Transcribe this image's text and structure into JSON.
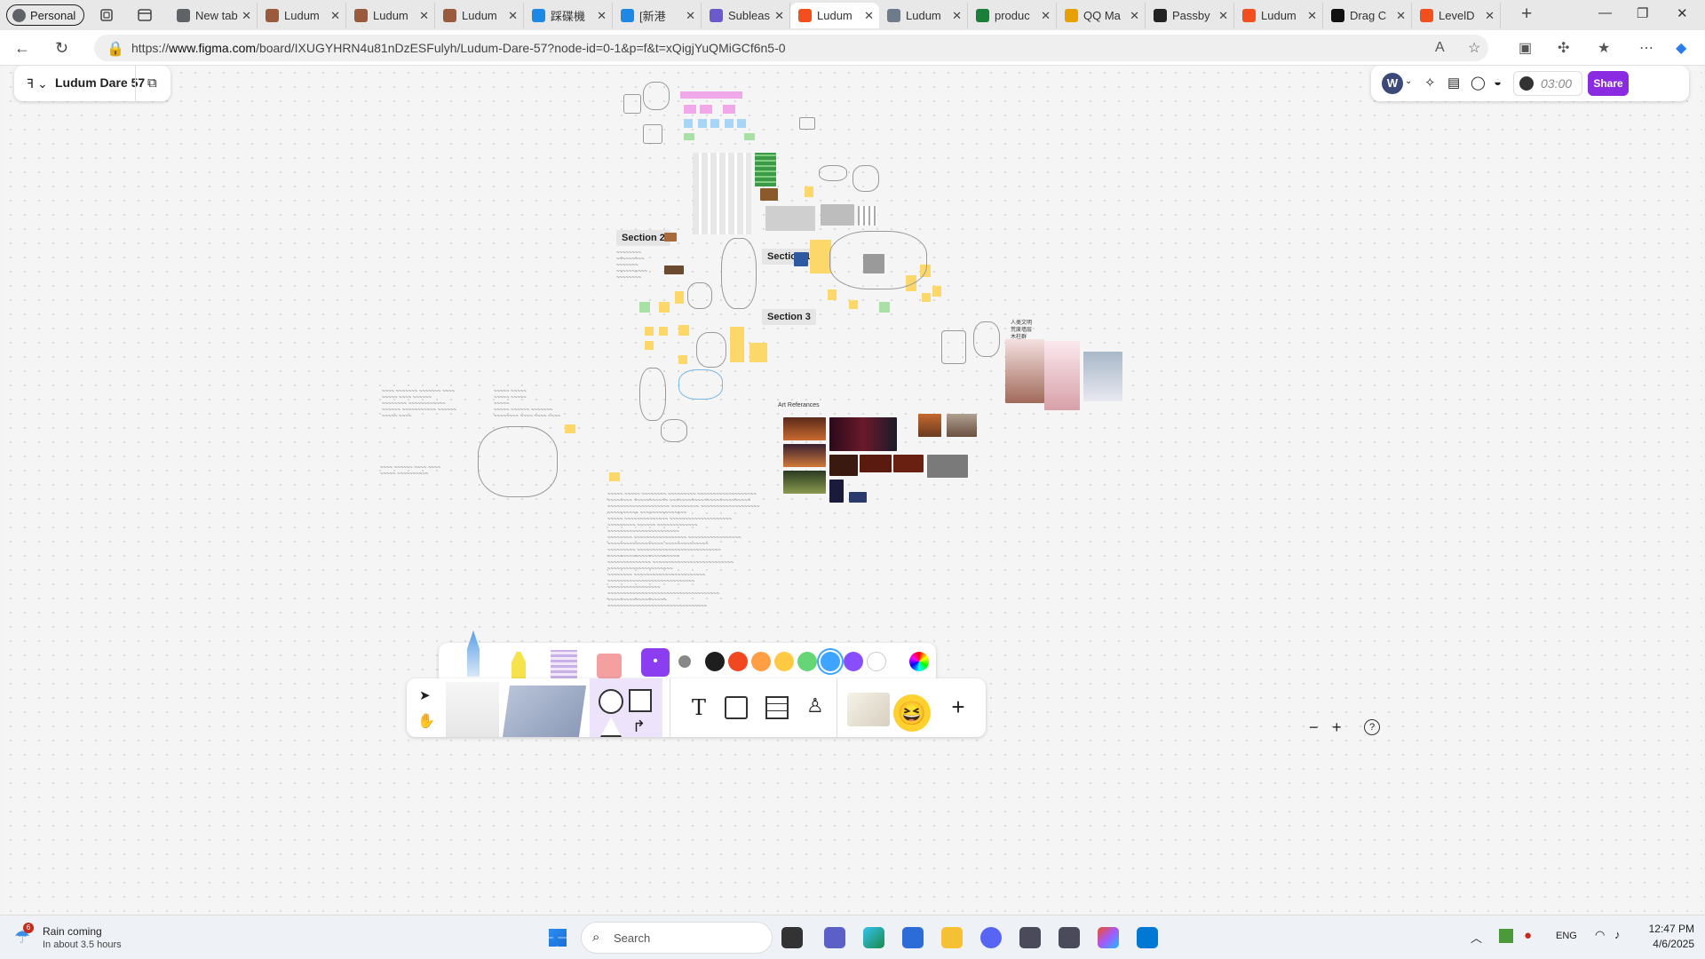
{
  "browser": {
    "profile_label": "Personal",
    "tabs": [
      {
        "title": "New tab",
        "color": "#5f6368",
        "active": false
      },
      {
        "title": "Ludum",
        "color": "#9a5b3c",
        "active": false
      },
      {
        "title": "Ludum",
        "color": "#9a5b3c",
        "active": false
      },
      {
        "title": "Ludum",
        "color": "#9a5b3c",
        "active": false
      },
      {
        "title": "踩碟機",
        "color": "#1e88e5",
        "active": false
      },
      {
        "title": "[新港",
        "color": "#1e88e5",
        "active": false
      },
      {
        "title": "Subleas",
        "color": "#6a5acd",
        "active": false
      },
      {
        "title": "Ludum",
        "color": "#f24e1e",
        "active": true
      },
      {
        "title": "Ludum",
        "color": "#6f7b8a",
        "active": false
      },
      {
        "title": "produc",
        "color": "#188038",
        "active": false
      },
      {
        "title": "QQ Ma",
        "color": "#e8a000",
        "active": false
      },
      {
        "title": "Passby",
        "color": "#222222",
        "active": false
      },
      {
        "title": "Ludum",
        "color": "#f24e1e",
        "active": false
      },
      {
        "title": "Drag C",
        "color": "#111111",
        "active": false
      },
      {
        "title": "LevelD",
        "color": "#f24e1e",
        "active": false
      }
    ],
    "url_prefix": "https://",
    "url_host": "www.figma.com",
    "url_path": "/board/IXUGYHRN4u81nDzESFulyh/Ludum-Dare-57?node-id=0-1&p=f&t=xQigjYuQMiGCf6n5-0"
  },
  "figma": {
    "file_name": "Ludum Dare 57",
    "avatar_letter": "W",
    "timer": "03:00",
    "share_label": "Share",
    "sections": [
      "Section 2",
      "Section 1",
      "Section 3"
    ],
    "art_ref_label": "Art Referances",
    "cn_note": [
      "人类文明",
      "荒废墙层",
      "木柱群"
    ],
    "toolbar_colors": [
      "#1e1e1e",
      "#f24822",
      "#ff9e42",
      "#ffc943",
      "#66d575",
      "#3da5ff",
      "#874fff",
      "#ffffff"
    ],
    "selected_color": "#3da5ff",
    "zoom_help": "?"
  },
  "taskbar": {
    "weather_badge": "6",
    "weather_title": "Rain coming",
    "weather_sub": "In about 3.5 hours",
    "search_placeholder": "Search",
    "lang": "ENG",
    "time": "12:47 PM",
    "date": "4/6/2025"
  }
}
